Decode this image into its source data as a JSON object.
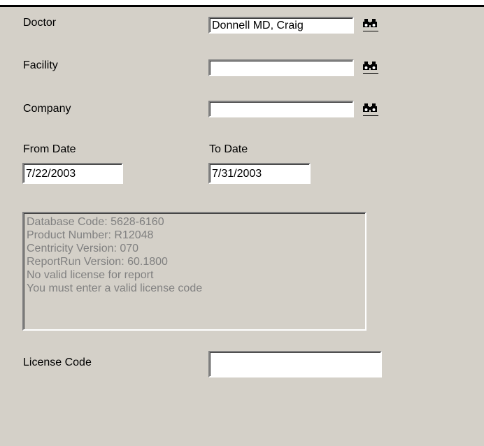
{
  "form": {
    "doctor": {
      "label": "Doctor",
      "value": "Donnell MD, Craig"
    },
    "facility": {
      "label": "Facility",
      "value": ""
    },
    "company": {
      "label": "Company",
      "value": ""
    },
    "from_date": {
      "label": "From Date",
      "value": "7/22/2003"
    },
    "to_date": {
      "label": "To Date",
      "value": "7/31/2003"
    },
    "license_code": {
      "label": "License Code",
      "value": ""
    }
  },
  "info": {
    "lines": [
      "Database Code: 5628-6160",
      "Product Number: R12048",
      "Centricity Version: 070",
      "ReportRun Version: 60.1800",
      "No valid license for report",
      "You must enter a valid license code"
    ]
  },
  "icons": {
    "lookup": "binoculars-icon"
  }
}
